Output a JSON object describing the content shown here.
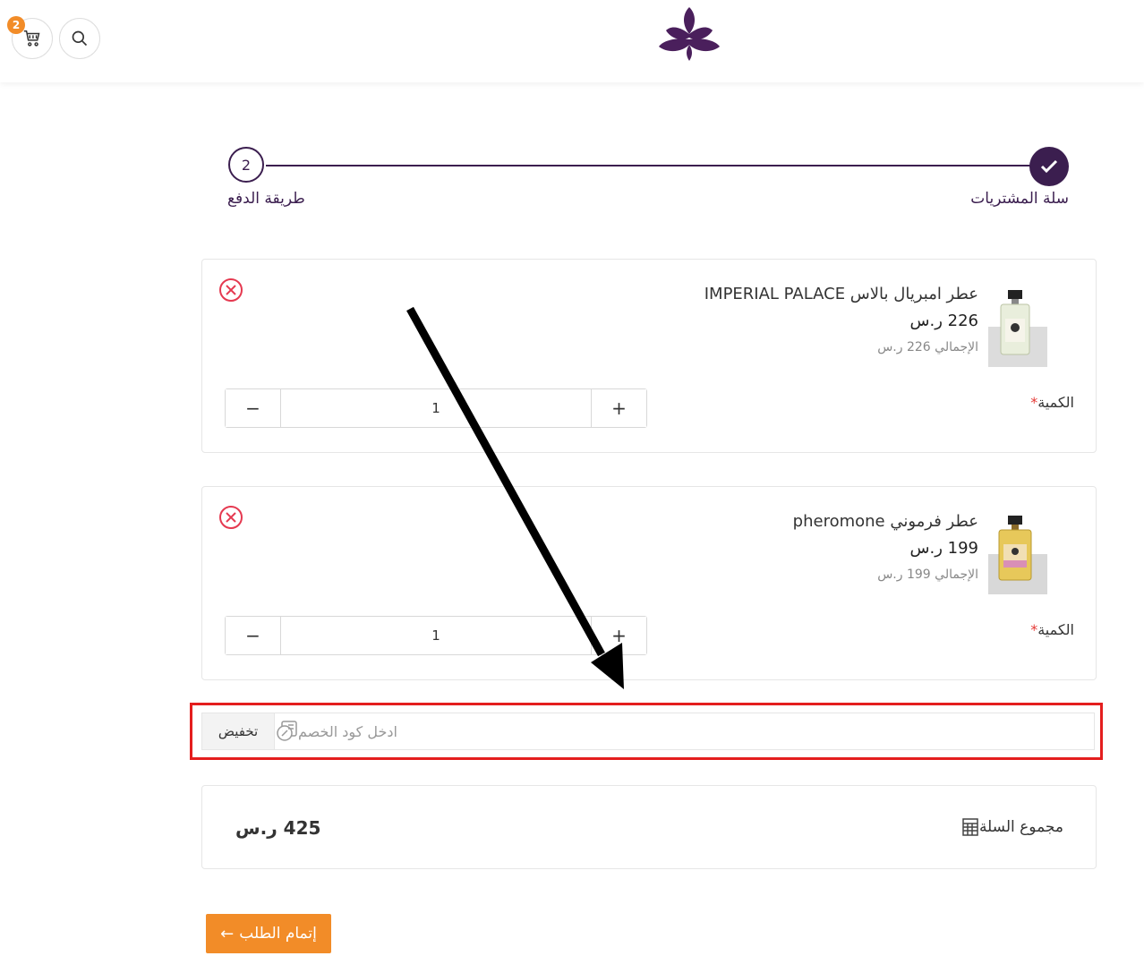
{
  "header": {
    "cart_badge": "2",
    "icons": [
      "cart-icon",
      "search-icon",
      "lotus-logo"
    ]
  },
  "stepper": {
    "steps": [
      {
        "label": "سلة المشتريات",
        "state": "completed"
      },
      {
        "label": "طريقة الدفع",
        "number": "2",
        "state": "pending"
      }
    ],
    "accent": "#3b1e4f"
  },
  "cart": {
    "items": [
      {
        "name": "عطر امبريال بالاس IMPERIAL PALACE",
        "price": "226 ر.س",
        "total": "الإجمالي 226 ر.س",
        "qty_label": "الكمية",
        "qty": "1",
        "minus": "−",
        "plus": "+"
      },
      {
        "name": "عطر فرموني pheromone",
        "price": "199 ر.س",
        "total": "الإجمالي 199 ر.س",
        "qty_label": "الكمية",
        "qty": "1",
        "minus": "−",
        "plus": "+"
      }
    ]
  },
  "coupon": {
    "placeholder": "ادخل كود الخصم",
    "button": "تخفيض"
  },
  "summary": {
    "label": "مجموع السلة",
    "value": "425 ر.س"
  },
  "checkout": {
    "label": "إتمام الطلب",
    "arrow": "←",
    "color": "#f28c28"
  },
  "annotation": {
    "highlight_color": "#e41e1e"
  }
}
